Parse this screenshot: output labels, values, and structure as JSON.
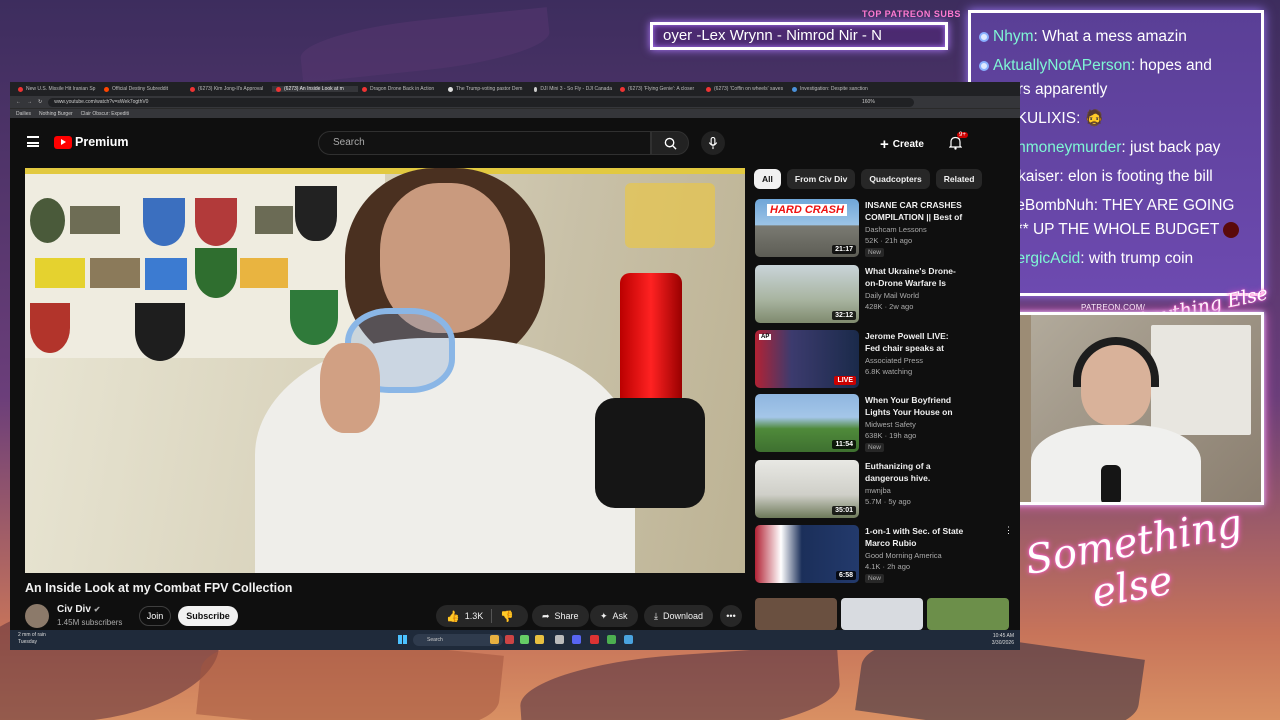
{
  "overlay": {
    "patreon_subs_label": "TOP PATREON SUBS",
    "ticker_text": "oyer -Lex Wrynn - Nimrod Nir - N",
    "patreon_url": "PATREON.COM/",
    "brand_top": "Anything Else",
    "brand_bottom_1": "Something",
    "brand_bottom_2": "else"
  },
  "chat": {
    "messages": [
      {
        "user": "Nhym",
        "text": ": What a mess amazin"
      },
      {
        "user": "AktuallyNotAPerson",
        "text": ": hopes and prayers apparently"
      },
      {
        "user": "KULIXIS",
        "text": ":"
      },
      {
        "user": "cashmoneymurder",
        "text": ": just back pay"
      },
      {
        "user": "vonkaiser",
        "text": ": elon is footing the bill"
      },
      {
        "user": "OweBombNuh",
        "text": ": THEY ARE GOING TO **** UP THE WHOLE BUDGET"
      },
      {
        "user": "LysergicAcid",
        "text": ": with trump coin"
      }
    ]
  },
  "browser": {
    "tabs": [
      "New U.S. Missile Hit Iranian Sp",
      "Official Destiny Subreddit",
      "(6273) Kim Jong-Il's Approval",
      "(6273) An Inside Look at m",
      "Dragon Drone Back in Action",
      "The Trump-voting pastor Dem",
      "DJI Mini 3 - So Fly - DJI Canada",
      "(6273) 'Flying Genie': A closer",
      "(6273) 'Coffin on wheels' saves",
      "Investigation: Despite sanction"
    ],
    "url": "www.youtube.com/watch?v=sWek7ogthV0",
    "zoom": "160%",
    "bookmarks": [
      "Dailies",
      "Nothing Burger",
      "Clair Obscur: Expediti"
    ]
  },
  "yt": {
    "brand": "Premium",
    "search_placeholder": "Search",
    "create_label": "Create",
    "notif_count": "9+",
    "video_title": "An Inside Look at my Combat FPV Collection",
    "channel_name": "Civ Div",
    "channel_subs": "1.45M subscribers",
    "join_label": "Join",
    "subscribe_label": "Subscribe",
    "like_count": "1.3K",
    "share_label": "Share",
    "ask_label": "Ask",
    "download_label": "Download",
    "chips": [
      "All",
      "From Civ Div",
      "Quadcopters",
      "Related"
    ],
    "recs": [
      {
        "title": "INSANE CAR CRASHES COMPILATION || Best of",
        "channel": "Dashcam Lessons",
        "meta": "52K · 21h ago",
        "duration": "21:17",
        "badge": "New",
        "thumb_text": "HARD CRASH"
      },
      {
        "title": "What Ukraine's Drone-on-Drone Warfare Is Really Like | Cr",
        "channel": "Daily Mail World",
        "meta": "428K · 2w ago",
        "duration": "32:12",
        "badge": "",
        "thumb_text": ""
      },
      {
        "title": "Jerome Powell LIVE: Fed chair speaks at Harvard",
        "channel": "Associated Press",
        "meta": "6.8K watching",
        "duration": "LIVE",
        "badge": "",
        "thumb_text": ""
      },
      {
        "title": "When Your Boyfriend Lights Your House on Fire",
        "channel": "Midwest Safety",
        "meta": "638K · 19h ago",
        "duration": "11:54",
        "badge": "New",
        "thumb_text": ""
      },
      {
        "title": "Euthanizing of a dangerous hive.",
        "channel": "mwnjba",
        "meta": "5.7M · 5y ago",
        "duration": "35:01",
        "badge": "",
        "thumb_text": ""
      },
      {
        "title": "1-on-1 with Sec. of State Marco Rubio",
        "channel": "Good Morning America",
        "meta": "4.1K · 2h ago",
        "duration": "6:58",
        "badge": "New",
        "thumb_text": ""
      }
    ]
  },
  "taskbar": {
    "weather": "2 mm of rain",
    "weather_day": "Tuesday",
    "search": "Search",
    "time": "10:45 AM",
    "date": "3/30/2026"
  }
}
